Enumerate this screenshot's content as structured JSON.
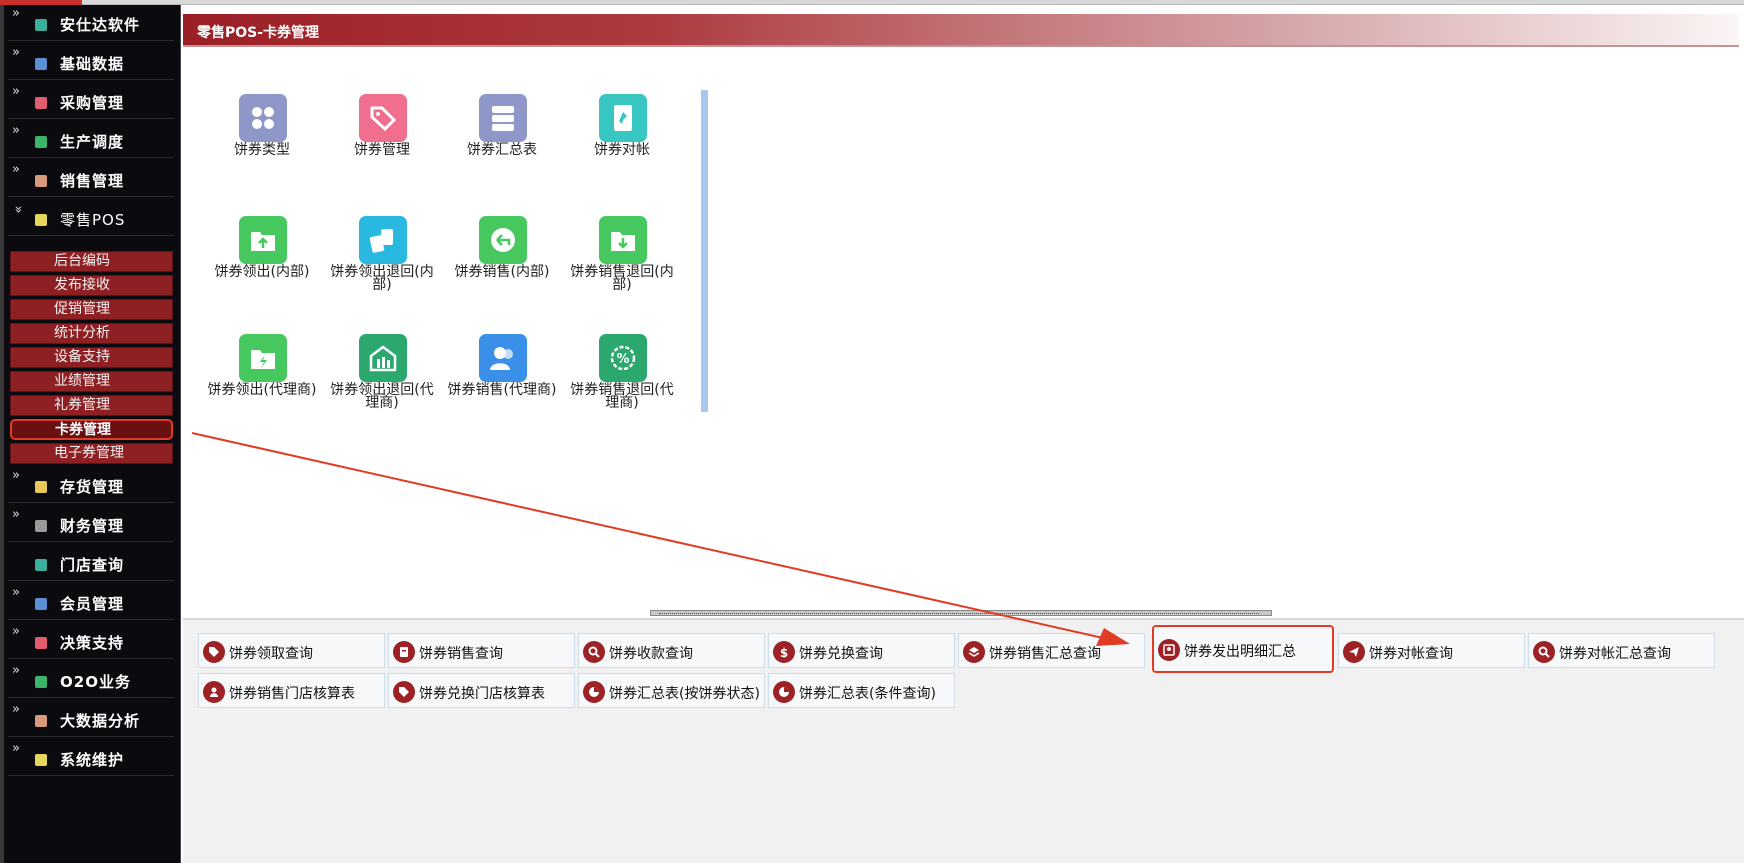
{
  "sidebar": {
    "items": [
      {
        "label": "安仕达软件",
        "icon_color": "#3cae9c",
        "expanded": false
      },
      {
        "label": "基础数据",
        "icon_color": "#5b8fd6",
        "expanded": false
      },
      {
        "label": "采购管理",
        "icon_color": "#e25c6f",
        "expanded": false
      },
      {
        "label": "生产调度",
        "icon_color": "#3ab56b",
        "expanded": false
      },
      {
        "label": "销售管理",
        "icon_color": "#d89a7a",
        "expanded": false
      },
      {
        "label": "零售POS",
        "icon_color": "#e8d65a",
        "expanded": true
      },
      {
        "label": "存货管理",
        "icon_color": "#e8c95a",
        "expanded": false
      },
      {
        "label": "财务管理",
        "icon_color": "#9a9a9a",
        "expanded": false
      },
      {
        "label": "门店查询",
        "icon_color": "#3cae9c",
        "expanded": false
      },
      {
        "label": "会员管理",
        "icon_color": "#5b8fd6",
        "expanded": false
      },
      {
        "label": "决策支持",
        "icon_color": "#e25c6f",
        "expanded": false
      },
      {
        "label": "O2O业务",
        "icon_color": "#3ab56b",
        "expanded": false
      },
      {
        "label": "大数据分析",
        "icon_color": "#d89a7a",
        "expanded": false
      },
      {
        "label": "系统维护",
        "icon_color": "#e8d65a",
        "expanded": false
      }
    ],
    "subitems": [
      "后台编码",
      "发布接收",
      "促销管理",
      "统计分析",
      "设备支持",
      "业绩管理",
      "礼券管理",
      "卡券管理",
      "电子券管理"
    ],
    "active_subitem": "卡券管理"
  },
  "header": {
    "title": "零售POS-卡券管理"
  },
  "tiles": [
    {
      "label": "饼券类型",
      "color": "#8f97c8",
      "icon": "grid-icon"
    },
    {
      "label": "饼券管理",
      "color": "#f06e8e",
      "icon": "tag-icon"
    },
    {
      "label": "饼券汇总表",
      "color": "#8f97c8",
      "icon": "server-icon"
    },
    {
      "label": "饼券对帐",
      "color": "#38c6c2",
      "icon": "pin-icon"
    },
    {
      "label": "饼券领出(内部)",
      "color": "#47c85e",
      "icon": "folder-up-icon"
    },
    {
      "label": "饼券领出退回(内部)",
      "color": "#28b8e0",
      "icon": "cards-icon"
    },
    {
      "label": "饼券销售(内部)",
      "color": "#47c85e",
      "icon": "return-icon"
    },
    {
      "label": "饼券销售退回(内部)",
      "color": "#47c85e",
      "icon": "folder-down-icon"
    },
    {
      "label": "饼券领出(代理商)",
      "color": "#47c85e",
      "icon": "folder-bolt-icon"
    },
    {
      "label": "饼券领出退回(代理商)",
      "color": "#2aa86e",
      "icon": "building-icon"
    },
    {
      "label": "饼券销售(代理商)",
      "color": "#3a8fe8",
      "icon": "users-icon"
    },
    {
      "label": "饼券销售退回(代理商)",
      "color": "#2aa86e",
      "icon": "percent-badge-icon"
    }
  ],
  "query_buttons": [
    {
      "label": "饼券领取查询",
      "icon": "tag-icon"
    },
    {
      "label": "饼券销售查询",
      "icon": "clipboard-icon"
    },
    {
      "label": "饼券收款查询",
      "icon": "search-icon"
    },
    {
      "label": "饼券兑换查询",
      "icon": "dollar-icon"
    },
    {
      "label": "饼券销售汇总查询",
      "icon": "layers-icon"
    },
    {
      "label": "饼券发出明细汇总",
      "icon": "contact-card-icon"
    },
    {
      "label": "饼券对帐查询",
      "icon": "send-icon"
    },
    {
      "label": "饼券对帐汇总查询",
      "icon": "search-icon"
    },
    {
      "label": "饼券销售门店核算表",
      "icon": "user-icon"
    },
    {
      "label": "饼券兑换门店核算表",
      "icon": "tag-icon"
    },
    {
      "label": "饼券汇总表(按饼券状态)",
      "icon": "pie-icon"
    },
    {
      "label": "饼券汇总表(条件查询)",
      "icon": "pie-icon"
    }
  ],
  "highlighted_button": "饼券发出明细汇总",
  "colors": {
    "sidebar_bg": "#0b0b0f",
    "submenu_bg": "#8e1f22",
    "accent": "#9b1f26",
    "annotation": "#e03b25"
  }
}
